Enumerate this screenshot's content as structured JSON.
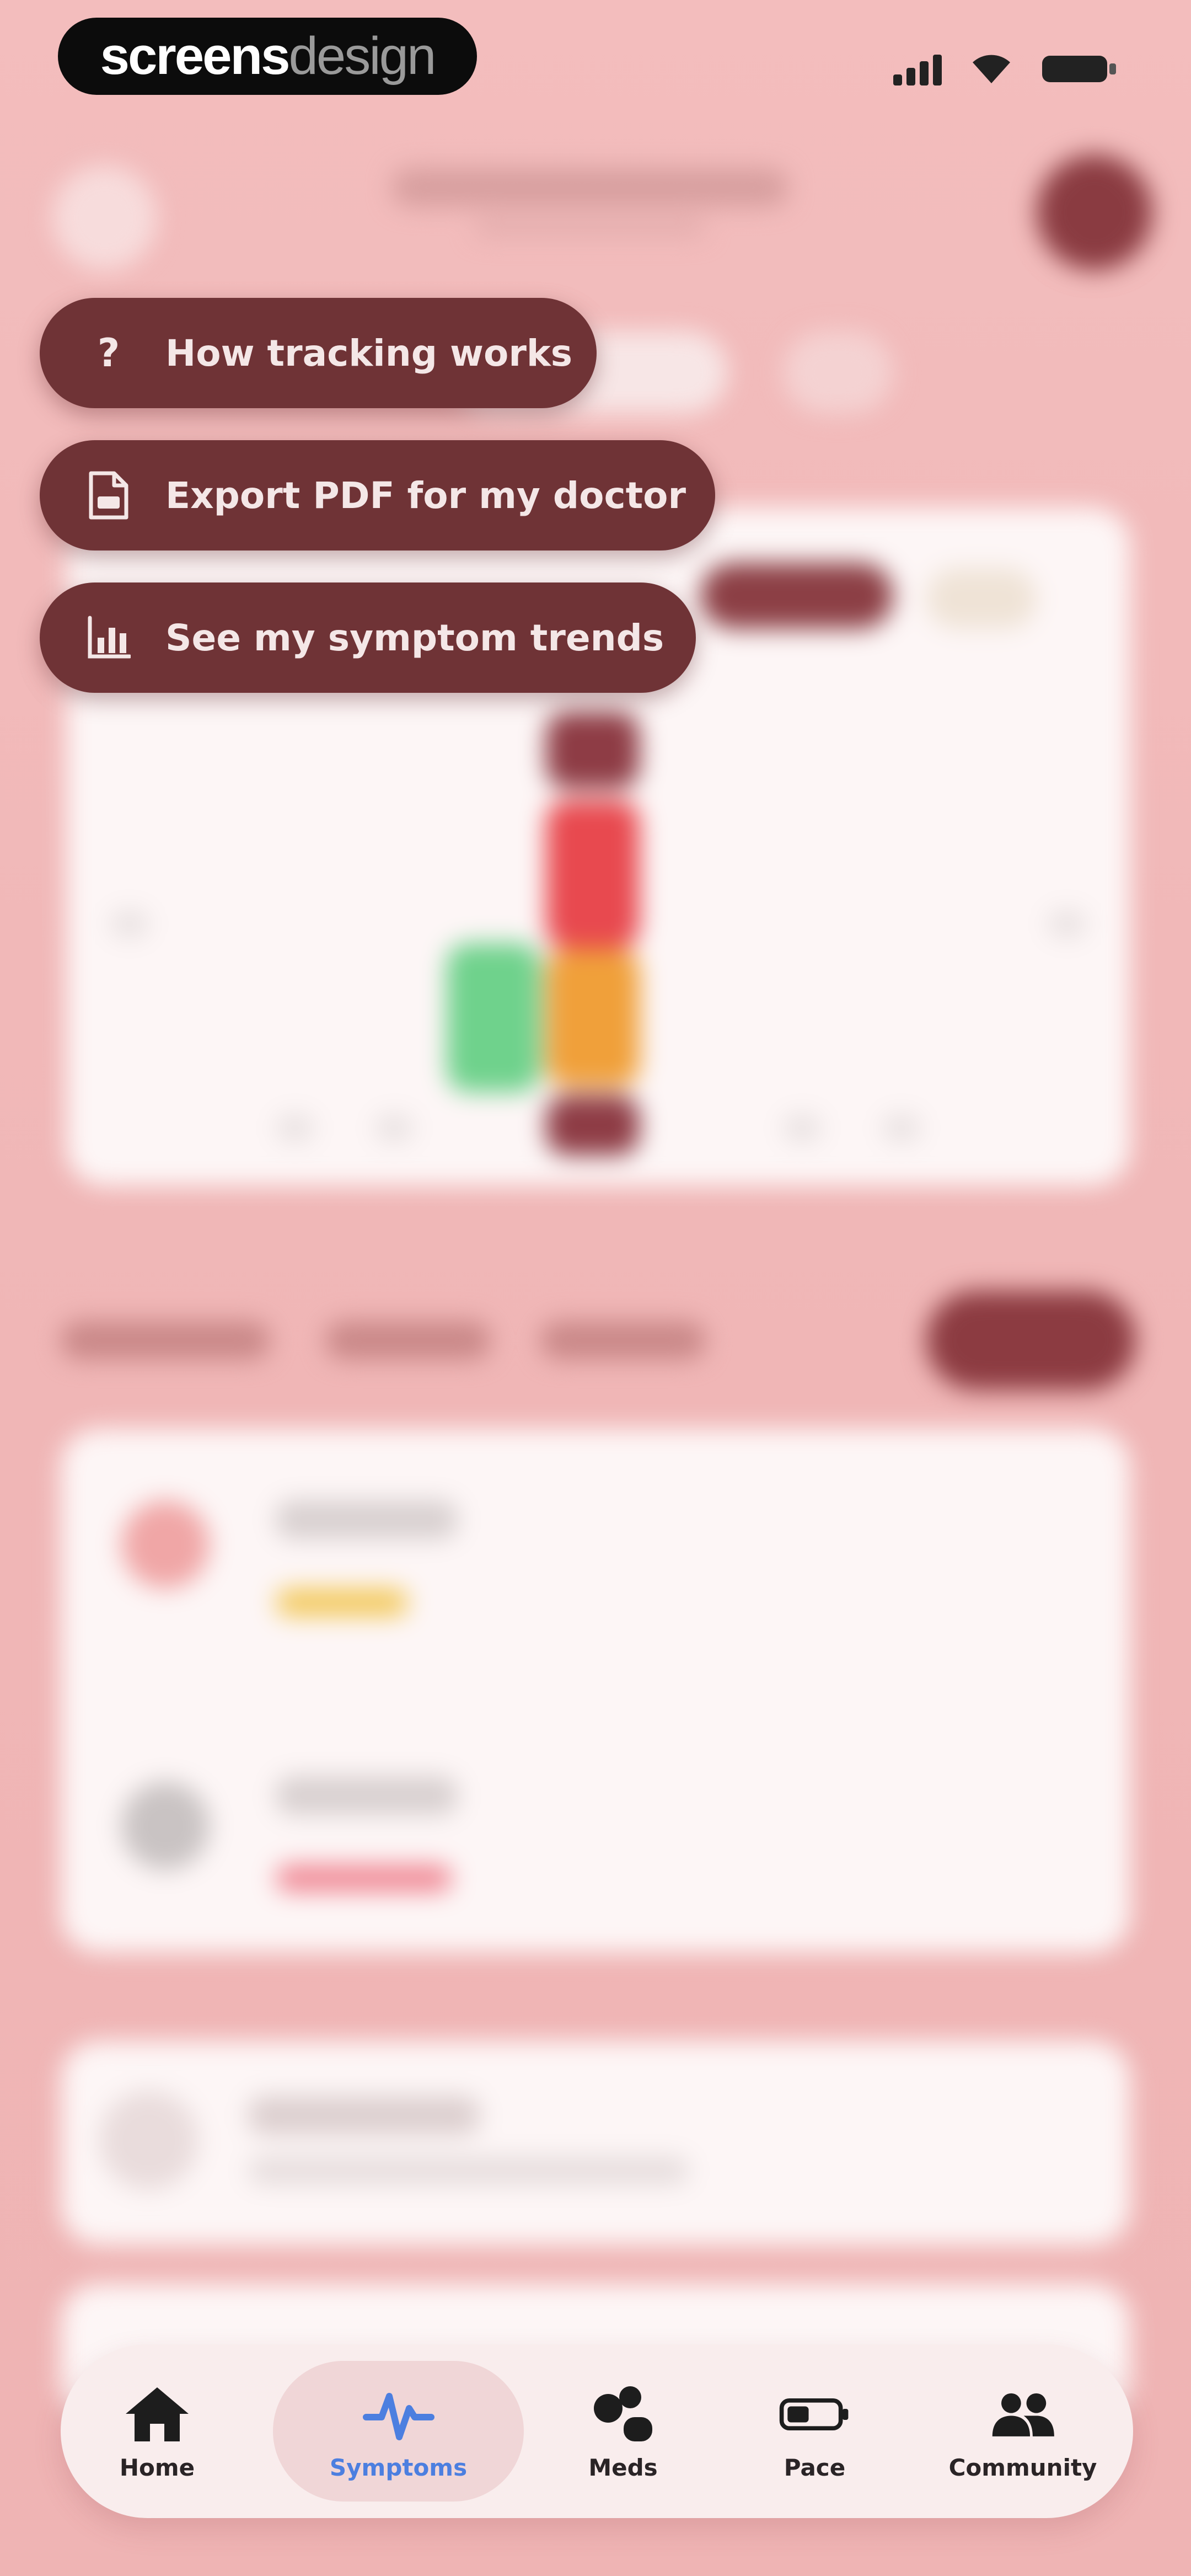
{
  "status_bar": {
    "brand_bold": "screens",
    "brand_light": "design"
  },
  "overlay_menu": {
    "items": [
      {
        "icon": "question-icon",
        "glyph": "?",
        "label": "How tracking works"
      },
      {
        "icon": "pdf-document-icon",
        "glyph": "",
        "label": "Export PDF for my doctor"
      },
      {
        "icon": "bar-chart-icon",
        "glyph": "",
        "label": "See my symptom trends"
      }
    ]
  },
  "tab_bar": {
    "active": "Symptoms",
    "active_color": "#4c7fe0",
    "items": [
      {
        "icon": "home-icon",
        "label": "Home"
      },
      {
        "icon": "heartbeat-icon",
        "label": "Symptoms"
      },
      {
        "icon": "pills-icon",
        "label": "Meds"
      },
      {
        "icon": "battery-icon",
        "label": "Pace"
      },
      {
        "icon": "people-icon",
        "label": "Community"
      }
    ]
  },
  "colors": {
    "background": "#f1b9b9",
    "menu_pill": "#6f3336",
    "accent_dark": "#8c3b41",
    "bar_green": "#6fd28c",
    "bar_red": "#e8494f",
    "bar_orange": "#f0a03a",
    "bar_maroon": "#8e3c45"
  }
}
